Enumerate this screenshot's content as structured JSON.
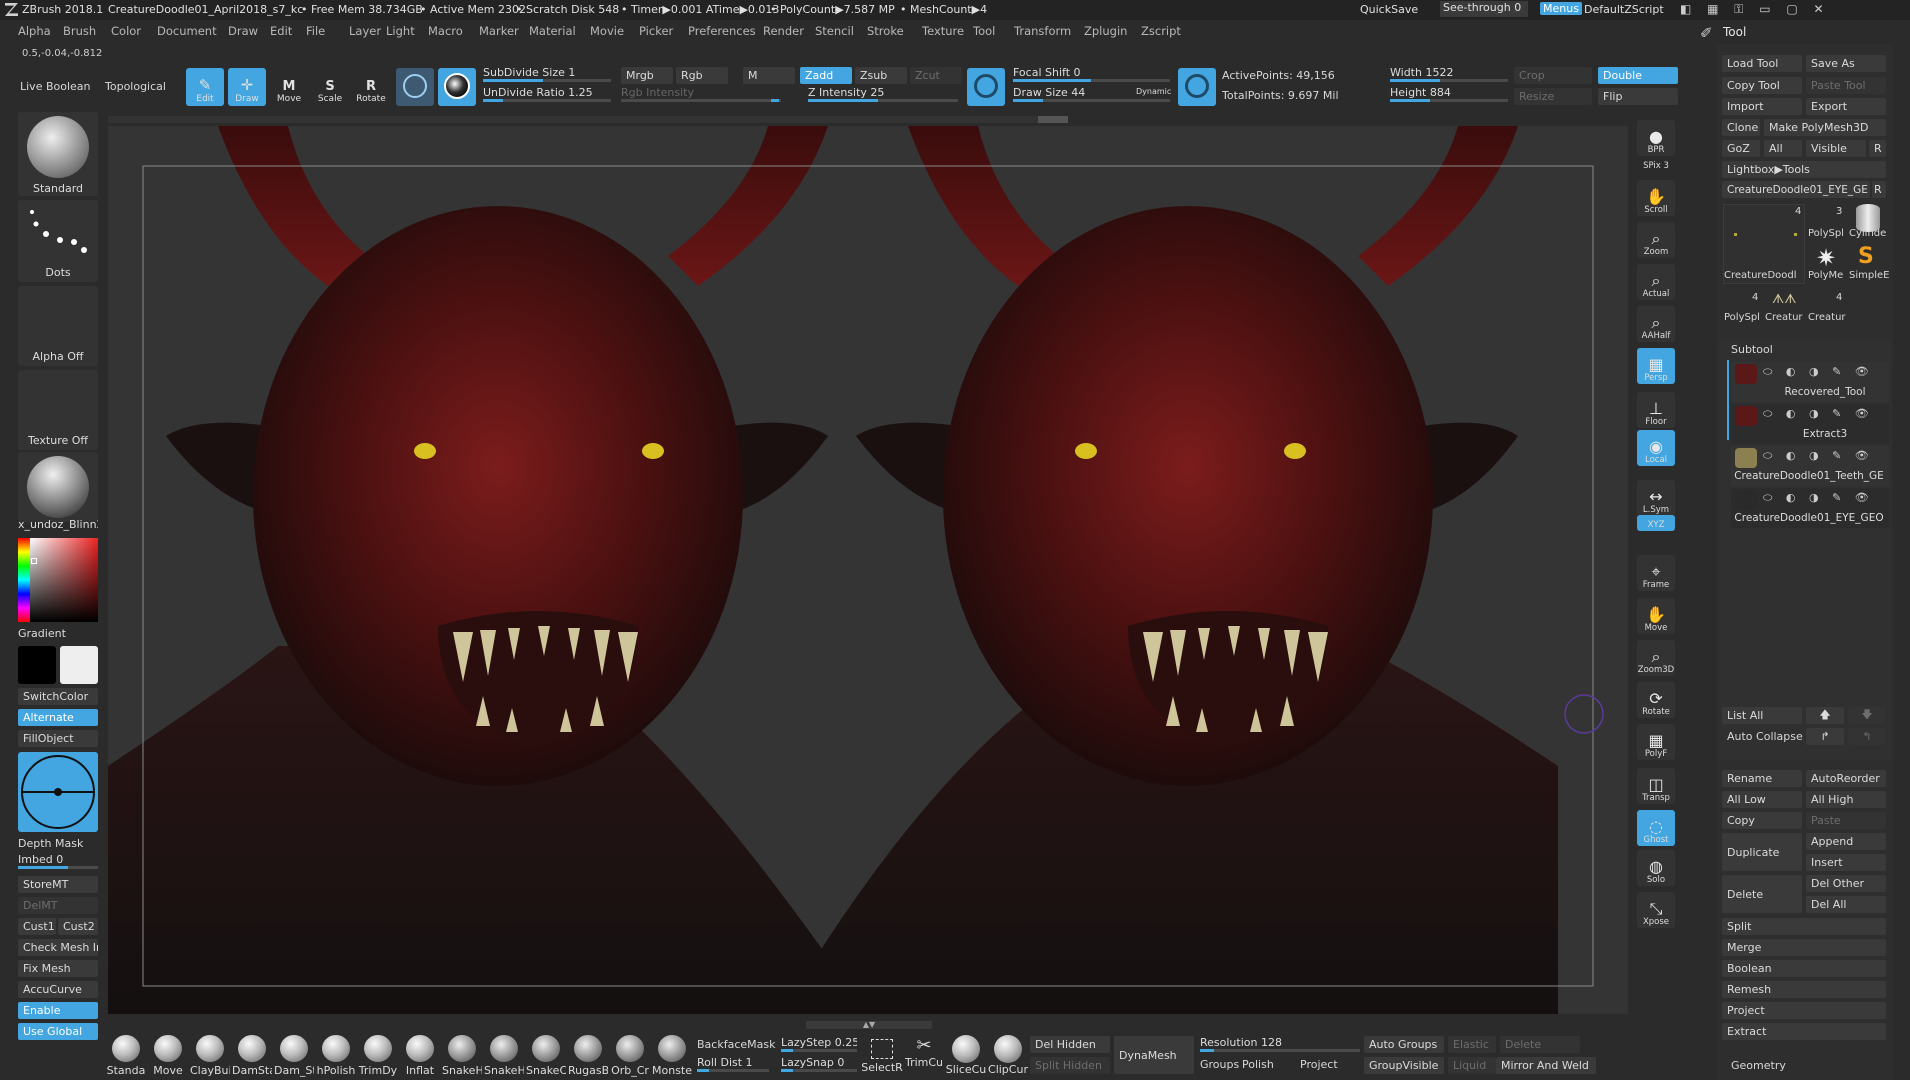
{
  "titlebar": {
    "app": "ZBrush 2018.1",
    "file": "CreatureDoodle01_April2018_s7_kc",
    "free_mem": "• Free Mem 38.734GB",
    "active_mem": "• Active Mem 2302",
    "scratch": "• Scratch Disk 548",
    "timer": "• Timer▶0.001 ATime▶0.013",
    "polycount": "• PolyCount▶7.587 MP",
    "meshcount": "• MeshCount▶4",
    "quicksave": "QuickSave",
    "seethrough": "See-through  0",
    "menus": "Menus",
    "script": "DefaultZScript"
  },
  "menubar": [
    "Alpha",
    "Brush",
    "Color",
    "Document",
    "Draw",
    "Edit",
    "File",
    "Layer",
    "Light",
    "Macro",
    "Marker",
    "Material",
    "Movie",
    "Picker",
    "Preferences",
    "Render",
    "Stencil",
    "Stroke",
    "Texture",
    "Tool",
    "Transform",
    "Zplugin",
    "Zscript"
  ],
  "coords": "0.5,-0.04,-0.812",
  "top": {
    "live_boolean": "Live Boolean",
    "topological": "Topological",
    "edit": "Edit",
    "draw": "Draw",
    "move": "Move",
    "scale": "Scale",
    "rotate": "Rotate",
    "subdivide": "SubDivide Size 1",
    "undivide": "UnDivide Ratio 1.25",
    "mrgb": "Mrgb",
    "rgb": "Rgb",
    "m": "M",
    "rgb_intensity": "Rgb Intensity",
    "zadd": "Zadd",
    "zsub": "Zsub",
    "zcut": "Zcut",
    "z_intensity": "Z Intensity 25",
    "focal": "Focal Shift 0",
    "draw_size": "Draw Size 44",
    "dynamic": "Dynamic",
    "active_points": "ActivePoints: 49,156",
    "total_points": "TotalPoints: 9.697 Mil",
    "width": "Width 1522",
    "height": "Height 884",
    "crop": "Crop",
    "resize": "Resize",
    "double": "Double",
    "flip": "Flip"
  },
  "left": {
    "brush": "Standard",
    "stroke": "Dots",
    "alpha": "Alpha Off",
    "texture": "Texture Off",
    "material": "x_undoz_Blinn2",
    "gradient": "Gradient",
    "switchcolor": "SwitchColor",
    "alternate": "Alternate",
    "fillobject": "FillObject",
    "depth_mask": "Depth Mask",
    "imbed": "Imbed 0",
    "storemt": "StoreMT",
    "delmt": "DelMT",
    "cust1": "Cust1",
    "cust2": "Cust2",
    "check_mesh": "Check Mesh In",
    "fix_mesh": "Fix Mesh",
    "accucurve": "AccuCurve",
    "enable": "Enable",
    "use_global": "Use Global"
  },
  "right_shelf": [
    {
      "name": "bpr",
      "label": "BPR"
    },
    {
      "name": "spix",
      "label": "SPix 3"
    },
    {
      "name": "scroll",
      "label": "Scroll"
    },
    {
      "name": "zoom",
      "label": "Zoom"
    },
    {
      "name": "actual",
      "label": "Actual"
    },
    {
      "name": "aahalf",
      "label": "AAHalf"
    },
    {
      "name": "persp",
      "label": "Persp"
    },
    {
      "name": "floor",
      "label": "Floor"
    },
    {
      "name": "local",
      "label": "Local"
    },
    {
      "name": "lsym",
      "label": "L.Sym"
    },
    {
      "name": "xyz",
      "label": "XYZ"
    },
    {
      "name": "frame",
      "label": "Frame"
    },
    {
      "name": "move",
      "label": "Move"
    },
    {
      "name": "zoom3d",
      "label": "Zoom3D"
    },
    {
      "name": "rotate",
      "label": "Rotate"
    },
    {
      "name": "polyf",
      "label": "PolyF"
    },
    {
      "name": "transp",
      "label": "Transp"
    },
    {
      "name": "ghost",
      "label": "Ghost"
    },
    {
      "name": "solo",
      "label": "Solo"
    },
    {
      "name": "xpose",
      "label": "Xpose"
    }
  ],
  "tool": {
    "title": "Tool",
    "load": "Load Tool",
    "saveas": "Save As",
    "copy": "Copy Tool",
    "paste": "Paste Tool",
    "import": "Import",
    "export": "Export",
    "clone": "Clone",
    "make": "Make PolyMesh3D",
    "goz": "GoZ",
    "all": "All",
    "visible": "Visible",
    "r": "R",
    "lightbox": "Lightbox▶Tools",
    "current": "CreatureDoodle01_EYE_GE",
    "r2": "R",
    "thumbs": [
      "CreatureDoodl",
      "PolySpl",
      "Cylinde",
      "PolyMe",
      "SimpleE",
      "PolySpl",
      "Creatur",
      "Creatur"
    ],
    "counts": [
      "4",
      "3",
      "4",
      "4"
    ],
    "subtool": "Subtool",
    "subtools": [
      "Recovered_Tool",
      "Extract3",
      "CreatureDoodle01_Teeth_GE",
      "CreatureDoodle01_EYE_GEO"
    ],
    "listall": "List All",
    "autocollapse": "Auto Collapse",
    "rename": "Rename",
    "autoreorder": "AutoReorder",
    "alllow": "All Low",
    "allhigh": "All High",
    "copy2": "Copy",
    "paste2": "Paste",
    "duplicate": "Duplicate",
    "append": "Append",
    "insert": "Insert",
    "delete": "Delete",
    "delother": "Del Other",
    "delall": "Del All",
    "split": "Split",
    "merge": "Merge",
    "boolean": "Boolean",
    "remesh": "Remesh",
    "project": "Project",
    "extract": "Extract",
    "geometry": "Geometry"
  },
  "bottom": {
    "brushes": [
      "Standa",
      "Move",
      "ClayBui",
      "DamSta",
      "Dam_St",
      "hPolish",
      "TrimDy",
      "Inflat",
      "SnakeH",
      "SnakeH",
      "SnakeC",
      "RugasB",
      "Orb_Cr",
      "Monste"
    ],
    "backface": "BackfaceMask",
    "rolldist": "Roll Dist 1",
    "lazystep": "LazyStep 0.25",
    "lazysnap": "LazySnap 0",
    "selectr": "SelectR",
    "trimcu": "TrimCu",
    "slicecu": "SliceCu",
    "clipcur": "ClipCur",
    "delhidden": "Del Hidden",
    "splithidden": "Split Hidden",
    "dynamesh": "DynaMesh",
    "resolution": "Resolution 128",
    "groups": "Groups",
    "polish": "Polish",
    "project": "Project",
    "autogroups": "Auto Groups",
    "groupvisible": "GroupVisible",
    "elastic": "Elastic",
    "liquid": "Liquid",
    "delete": "Delete",
    "mirrorweld": "Mirror And Weld"
  }
}
